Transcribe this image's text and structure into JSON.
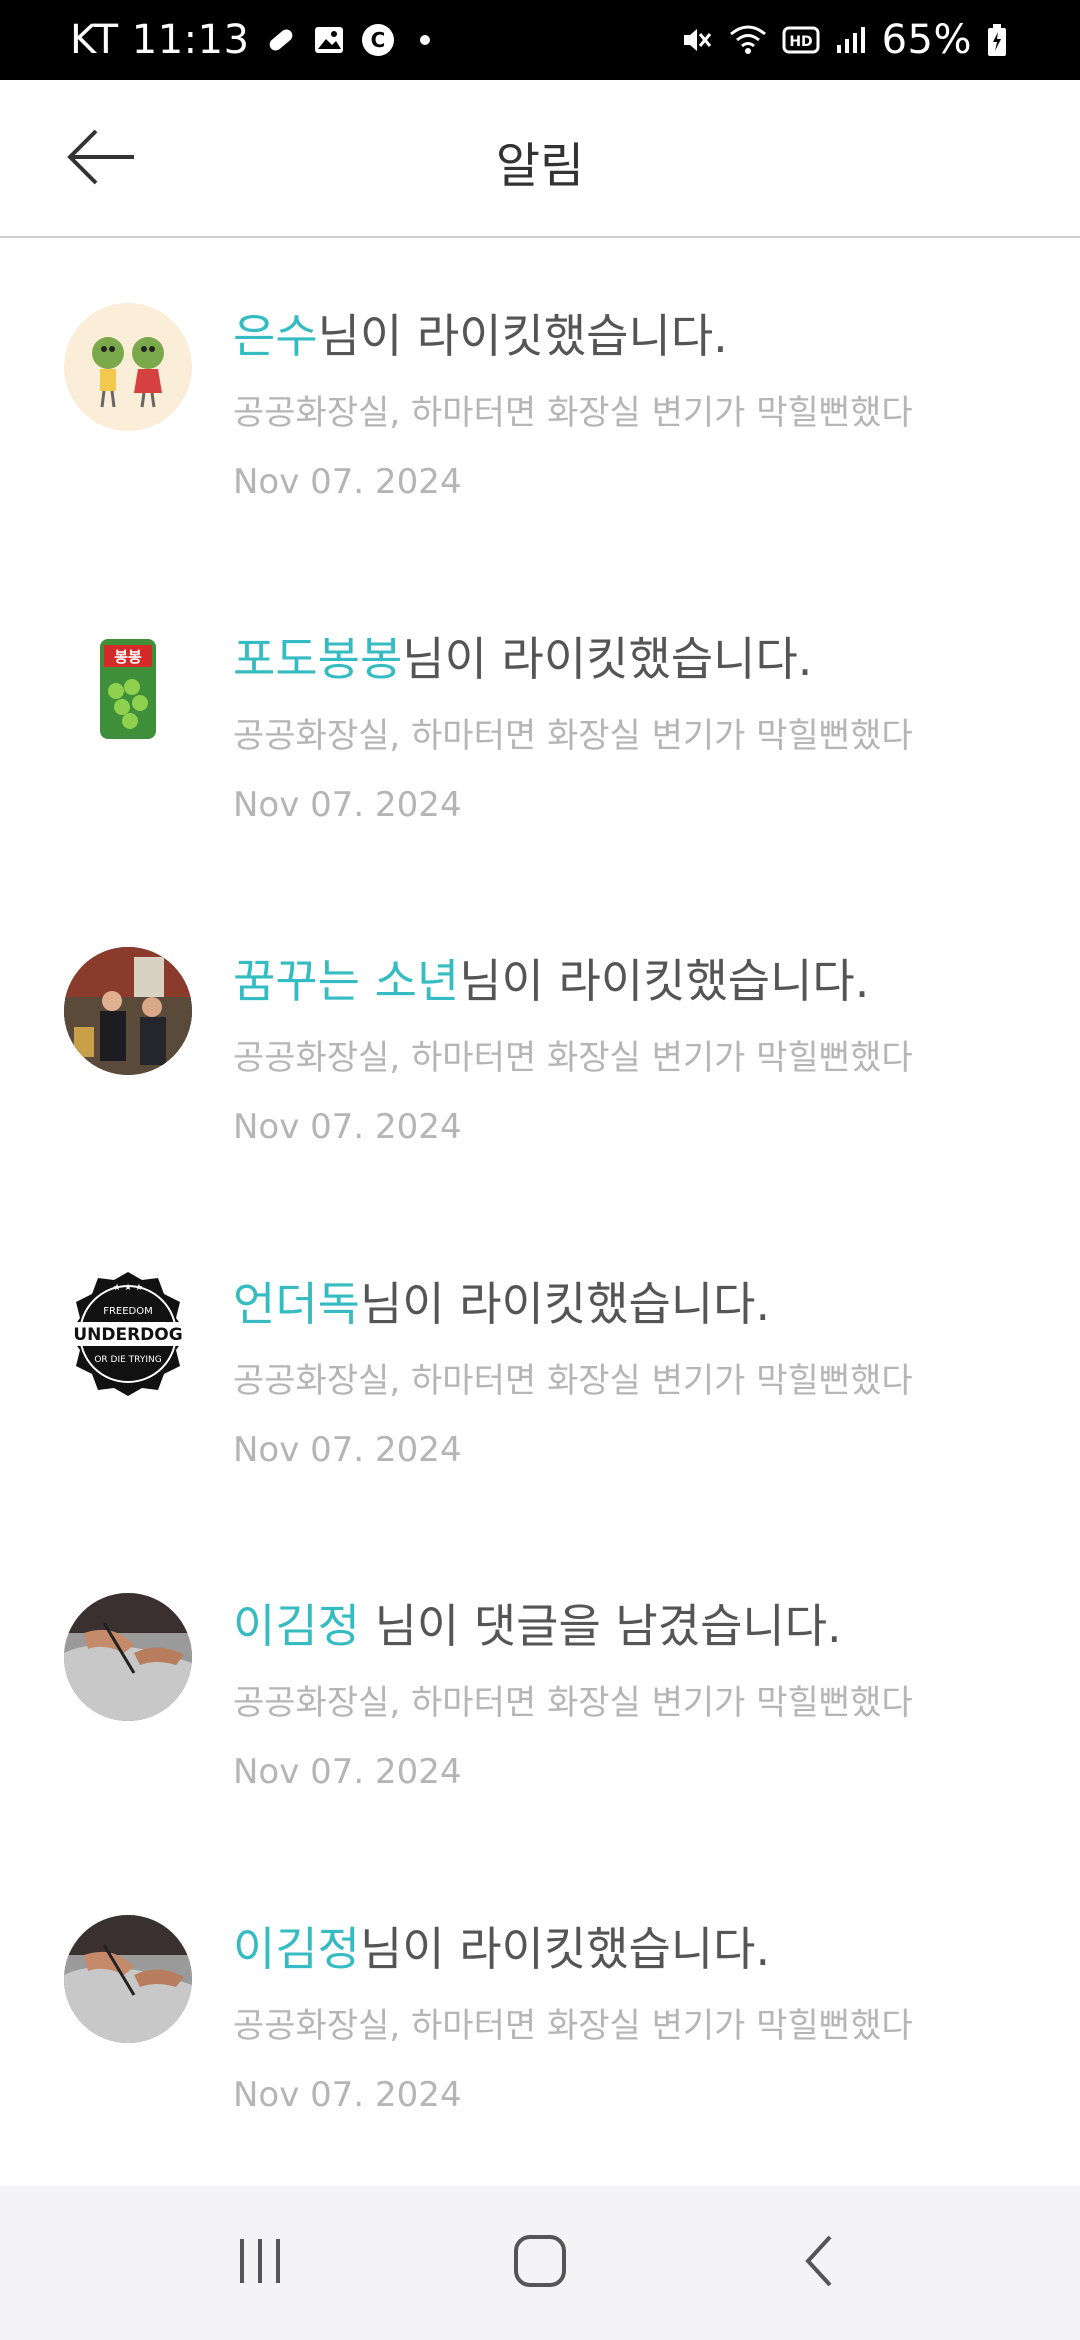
{
  "status_bar": {
    "carrier_time": "KT 11:13",
    "battery": "65%",
    "left_icons": [
      "pill-icon",
      "image-icon",
      "c-badge-icon",
      "dot-icon"
    ],
    "right_icons": [
      "mute-icon",
      "wifi-icon",
      "hd-icon",
      "signal-icon",
      "battery-icon"
    ]
  },
  "header": {
    "title": "알림",
    "back_icon": "back-arrow-icon"
  },
  "notifications": [
    {
      "name": "은수",
      "action": "님이 라이킷했습니다.",
      "post": "공공화장실, 하마터면 화장실 변기가 막힐뻔했다",
      "date": "Nov 07. 2024",
      "avatar": "veggie-couple"
    },
    {
      "name": "포도봉봉",
      "action": "님이 라이킷했습니다.",
      "post": "공공화장실, 하마터면 화장실 변기가 막힐뻔했다",
      "date": "Nov 07. 2024",
      "avatar": "grape-can"
    },
    {
      "name": "꿈꾸는 소년",
      "action": "님이 라이킷했습니다.",
      "post": "공공화장실, 하마터면 화장실 변기가 막힐뻔했다",
      "date": "Nov 07. 2024",
      "avatar": "photo-people"
    },
    {
      "name": "언더독",
      "action": "님이 라이킷했습니다.",
      "post": "공공화장실, 하마터면 화장실 변기가 막힐뻔했다",
      "date": "Nov 07. 2024",
      "avatar": "underdog-badge",
      "avatar_text": {
        "top": "FREEDOM",
        "main": "UNDERDOG",
        "bottom": "OR DIE TRYING"
      }
    },
    {
      "name": "이김정",
      "action": " 님이 댓글을 남겼습니다.",
      "post": "공공화장실, 하마터면 화장실 변기가 막힐뻔했다",
      "date": "Nov 07. 2024",
      "avatar": "hands-photo"
    },
    {
      "name": "이김정",
      "action": "님이 라이킷했습니다.",
      "post": "공공화장실, 하마터면 화장실 변기가 막힐뻔했다",
      "date": "Nov 07. 2024",
      "avatar": "hands-photo"
    }
  ],
  "nav_bar": {
    "recents_icon": "recents-icon",
    "home_icon": "home-icon",
    "back_icon": "nav-back-icon"
  },
  "colors": {
    "accent": "#35bcc3",
    "text": "#555555",
    "muted": "#b5b5b5",
    "status_bg": "#000000",
    "nav_bg": "#f4f4f6"
  }
}
